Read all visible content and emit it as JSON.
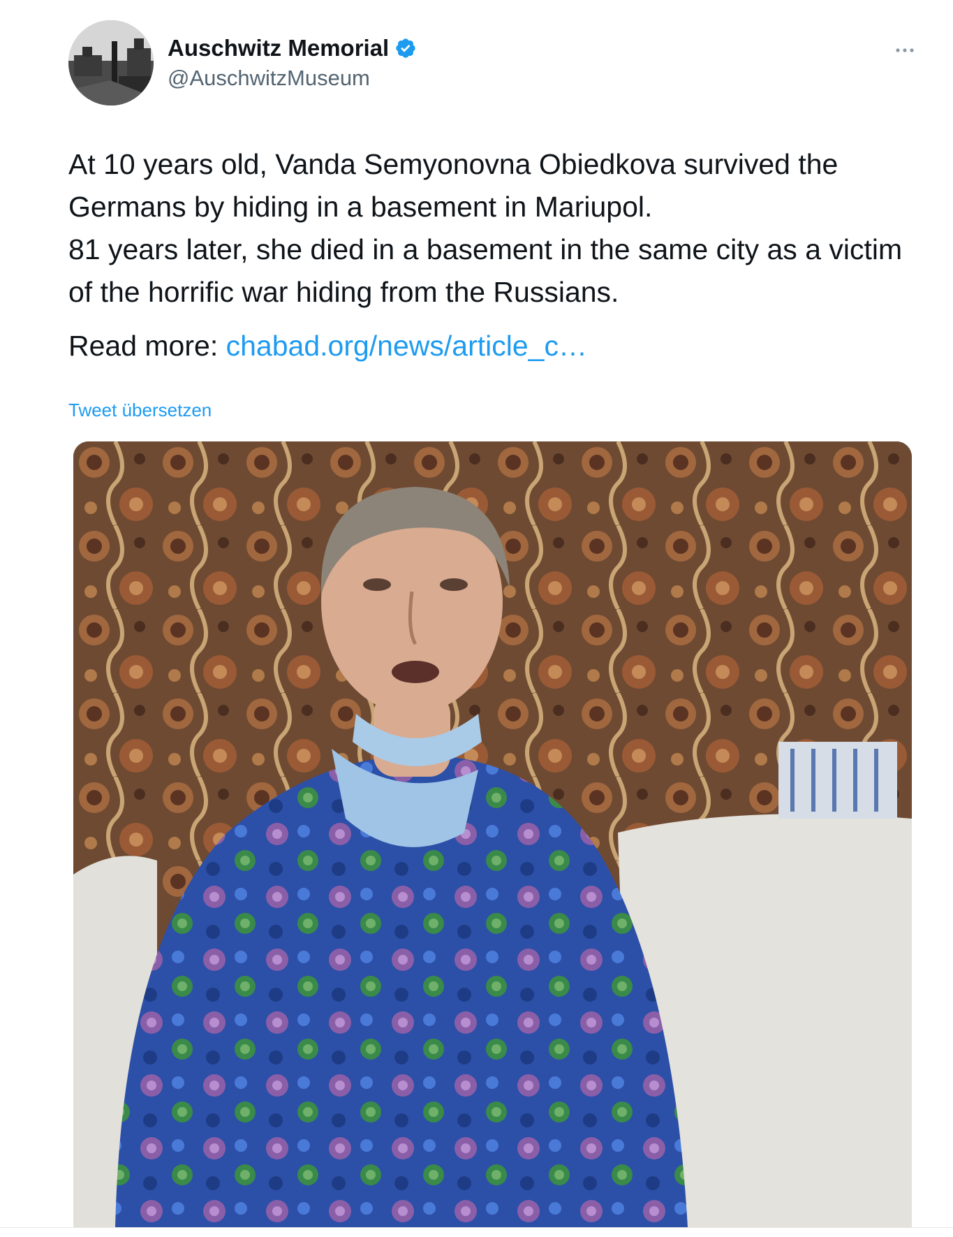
{
  "account": {
    "display_name": "Auschwitz Memorial",
    "handle": "@AuschwitzMuseum",
    "verified": true
  },
  "tweet": {
    "lines": [
      "At 10 years old, Vanda Semyonovna Obiedkova survived the Germans by hiding in a basement in Mariupol.",
      "81 years later, she died in a basement in the same city as a victim of the horrific war hiding from the Russians."
    ],
    "read_more_label": "Read more:",
    "link_text": "chabad.org/news/article_c…",
    "translate_label": "Tweet übersetzen"
  },
  "icons": {
    "verified": "verified-badge-icon",
    "more": "more-options-icon"
  },
  "colors": {
    "link": "#1d9bf0",
    "text": "#0f1419",
    "secondary": "#536471"
  }
}
